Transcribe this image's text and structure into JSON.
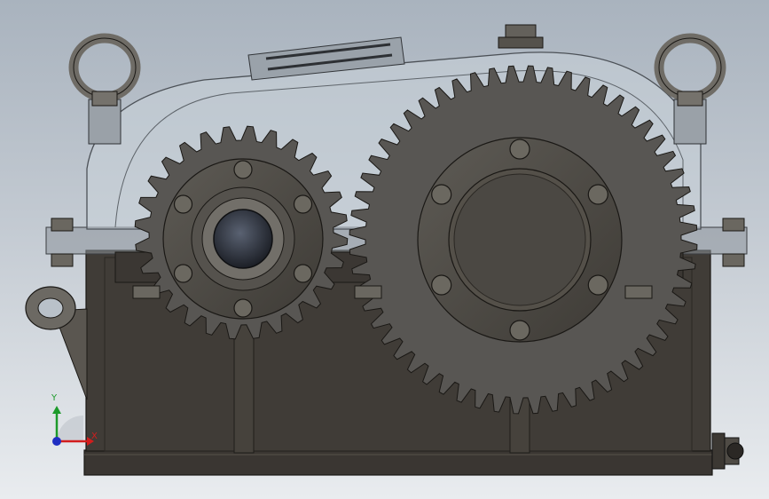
{
  "viewport": {
    "scene": "gearbox-model",
    "background_top": "#a9b3be",
    "background_bottom": "#e9ecef"
  },
  "model": {
    "housing_color": "#3f3b36",
    "cover_color": "#c9d3dc",
    "gear_color": "#585653",
    "bolt_color": "#6b6860",
    "pinion_teeth": 28,
    "wheel_teeth": 56
  },
  "triad": {
    "x_label": "X",
    "y_label": "Y",
    "x_color": "#d21d1d",
    "y_color": "#1c9a2a",
    "z_color": "#1f2fc2"
  }
}
